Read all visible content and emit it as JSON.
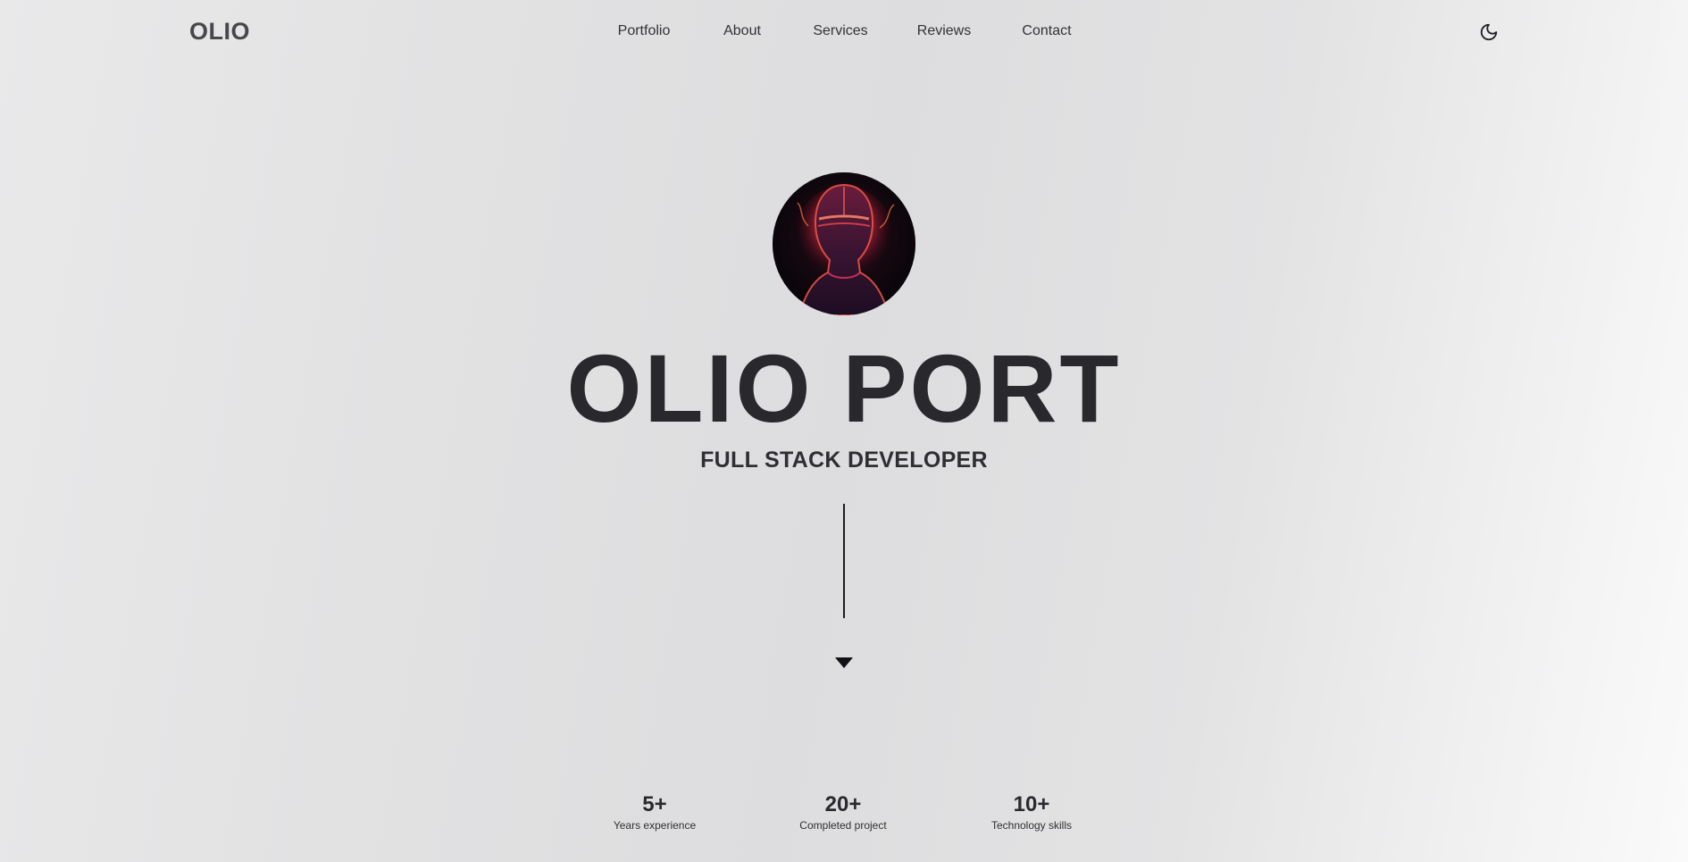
{
  "header": {
    "logo": "OLIO",
    "nav": [
      "Portfolio",
      "About",
      "Services",
      "Reviews",
      "Contact"
    ],
    "theme_toggle_icon": "moon-icon"
  },
  "hero": {
    "avatar_icon": "avatar-image",
    "title": "OLIO PORT",
    "subtitle": "FULL STACK DEVELOPER",
    "scroll_icon": "caret-down-icon"
  },
  "stats": [
    {
      "value": "5+",
      "label": "Years experience"
    },
    {
      "value": "20+",
      "label": "Completed project"
    },
    {
      "value": "10+",
      "label": "Technology skills"
    }
  ],
  "colors": {
    "text_dark": "#29282c",
    "logo": "#48474b",
    "background": "#e2e2e3"
  }
}
